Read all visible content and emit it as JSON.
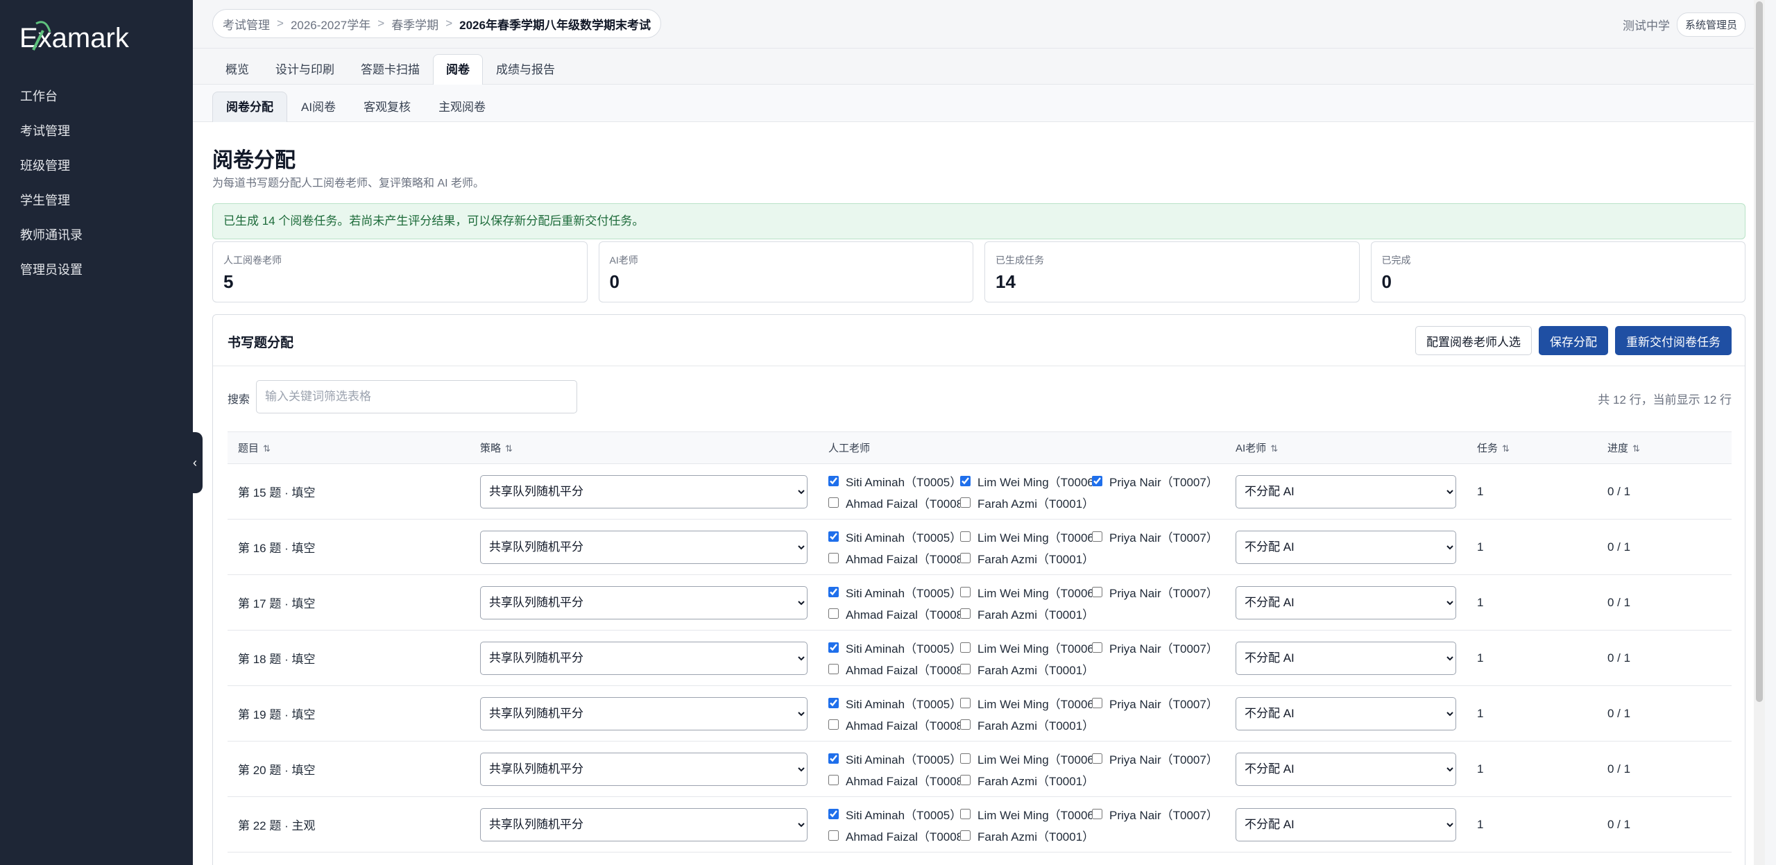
{
  "app": {
    "logo_text": "Examark",
    "nav": [
      "工作台",
      "考试管理",
      "班级管理",
      "学生管理",
      "教师通讯录",
      "管理员设置"
    ],
    "collapse_icon": "chevron-left-icon"
  },
  "header": {
    "breadcrumb": [
      "考试管理",
      "2026-2027学年",
      "春季学期",
      "2026年春季学期八年级数学期末考试"
    ],
    "school": "测试中学",
    "role": "系统管理员"
  },
  "tabs": {
    "primary": [
      "概览",
      "设计与印刷",
      "答题卡扫描",
      "阅卷",
      "成绩与报告"
    ],
    "primary_active": "阅卷",
    "secondary": [
      "阅卷分配",
      "AI阅卷",
      "客观复核",
      "主观阅卷"
    ],
    "secondary_active": "阅卷分配"
  },
  "page": {
    "title": "阅卷分配",
    "subtitle": "为每道书写题分配人工阅卷老师、复评策略和 AI 老师。",
    "alert": "已生成 14 个阅卷任务。若尚未产生评分结果，可以保存新分配后重新交付任务。"
  },
  "stats": [
    {
      "label": "人工阅卷老师",
      "value": "5"
    },
    {
      "label": "AI老师",
      "value": "0"
    },
    {
      "label": "已生成任务",
      "value": "14"
    },
    {
      "label": "已完成",
      "value": "0"
    }
  ],
  "panel": {
    "title": "书写题分配",
    "btn_config": "配置阅卷老师人选",
    "btn_save": "保存分配",
    "btn_redeliver": "重新交付阅卷任务",
    "search_label": "搜索",
    "search_placeholder": "输入关键词筛选表格",
    "search_value": "",
    "row_count": "共 12 行，当前显示 12 行"
  },
  "table": {
    "headers": [
      "题目",
      "策略",
      "人工老师",
      "AI老师",
      "任务",
      "进度"
    ],
    "teachers": [
      "Siti Aminah（T0005）",
      "Lim Wei Ming（T0006）",
      "Priya Nair（T0007）",
      "Ahmad Faizal（T0008）",
      "Farah Azmi（T0001）"
    ],
    "rows": [
      {
        "question": "第 15 题 · 填空",
        "strategy": "共享队列随机平分",
        "checked": [
          true,
          true,
          true,
          false,
          false
        ],
        "ai": "不分配 AI",
        "tasks": "1",
        "progress": "0 / 1"
      },
      {
        "question": "第 16 题 · 填空",
        "strategy": "共享队列随机平分",
        "checked": [
          true,
          false,
          false,
          false,
          false
        ],
        "ai": "不分配 AI",
        "tasks": "1",
        "progress": "0 / 1"
      },
      {
        "question": "第 17 题 · 填空",
        "strategy": "共享队列随机平分",
        "checked": [
          true,
          false,
          false,
          false,
          false
        ],
        "ai": "不分配 AI",
        "tasks": "1",
        "progress": "0 / 1"
      },
      {
        "question": "第 18 题 · 填空",
        "strategy": "共享队列随机平分",
        "checked": [
          true,
          false,
          false,
          false,
          false
        ],
        "ai": "不分配 AI",
        "tasks": "1",
        "progress": "0 / 1"
      },
      {
        "question": "第 19 题 · 填空",
        "strategy": "共享队列随机平分",
        "checked": [
          true,
          false,
          false,
          false,
          false
        ],
        "ai": "不分配 AI",
        "tasks": "1",
        "progress": "0 / 1"
      },
      {
        "question": "第 20 题 · 填空",
        "strategy": "共享队列随机平分",
        "checked": [
          true,
          false,
          false,
          false,
          false
        ],
        "ai": "不分配 AI",
        "tasks": "1",
        "progress": "0 / 1"
      },
      {
        "question": "第 22 题 · 主观",
        "strategy": "共享队列随机平分",
        "checked": [
          true,
          false,
          false,
          false,
          false
        ],
        "ai": "不分配 AI",
        "tasks": "1",
        "progress": "0 / 1"
      },
      {
        "question": "",
        "strategy": "",
        "checked": [
          true,
          false,
          false,
          false,
          false
        ],
        "ai": "",
        "tasks": "",
        "progress": ""
      }
    ]
  }
}
